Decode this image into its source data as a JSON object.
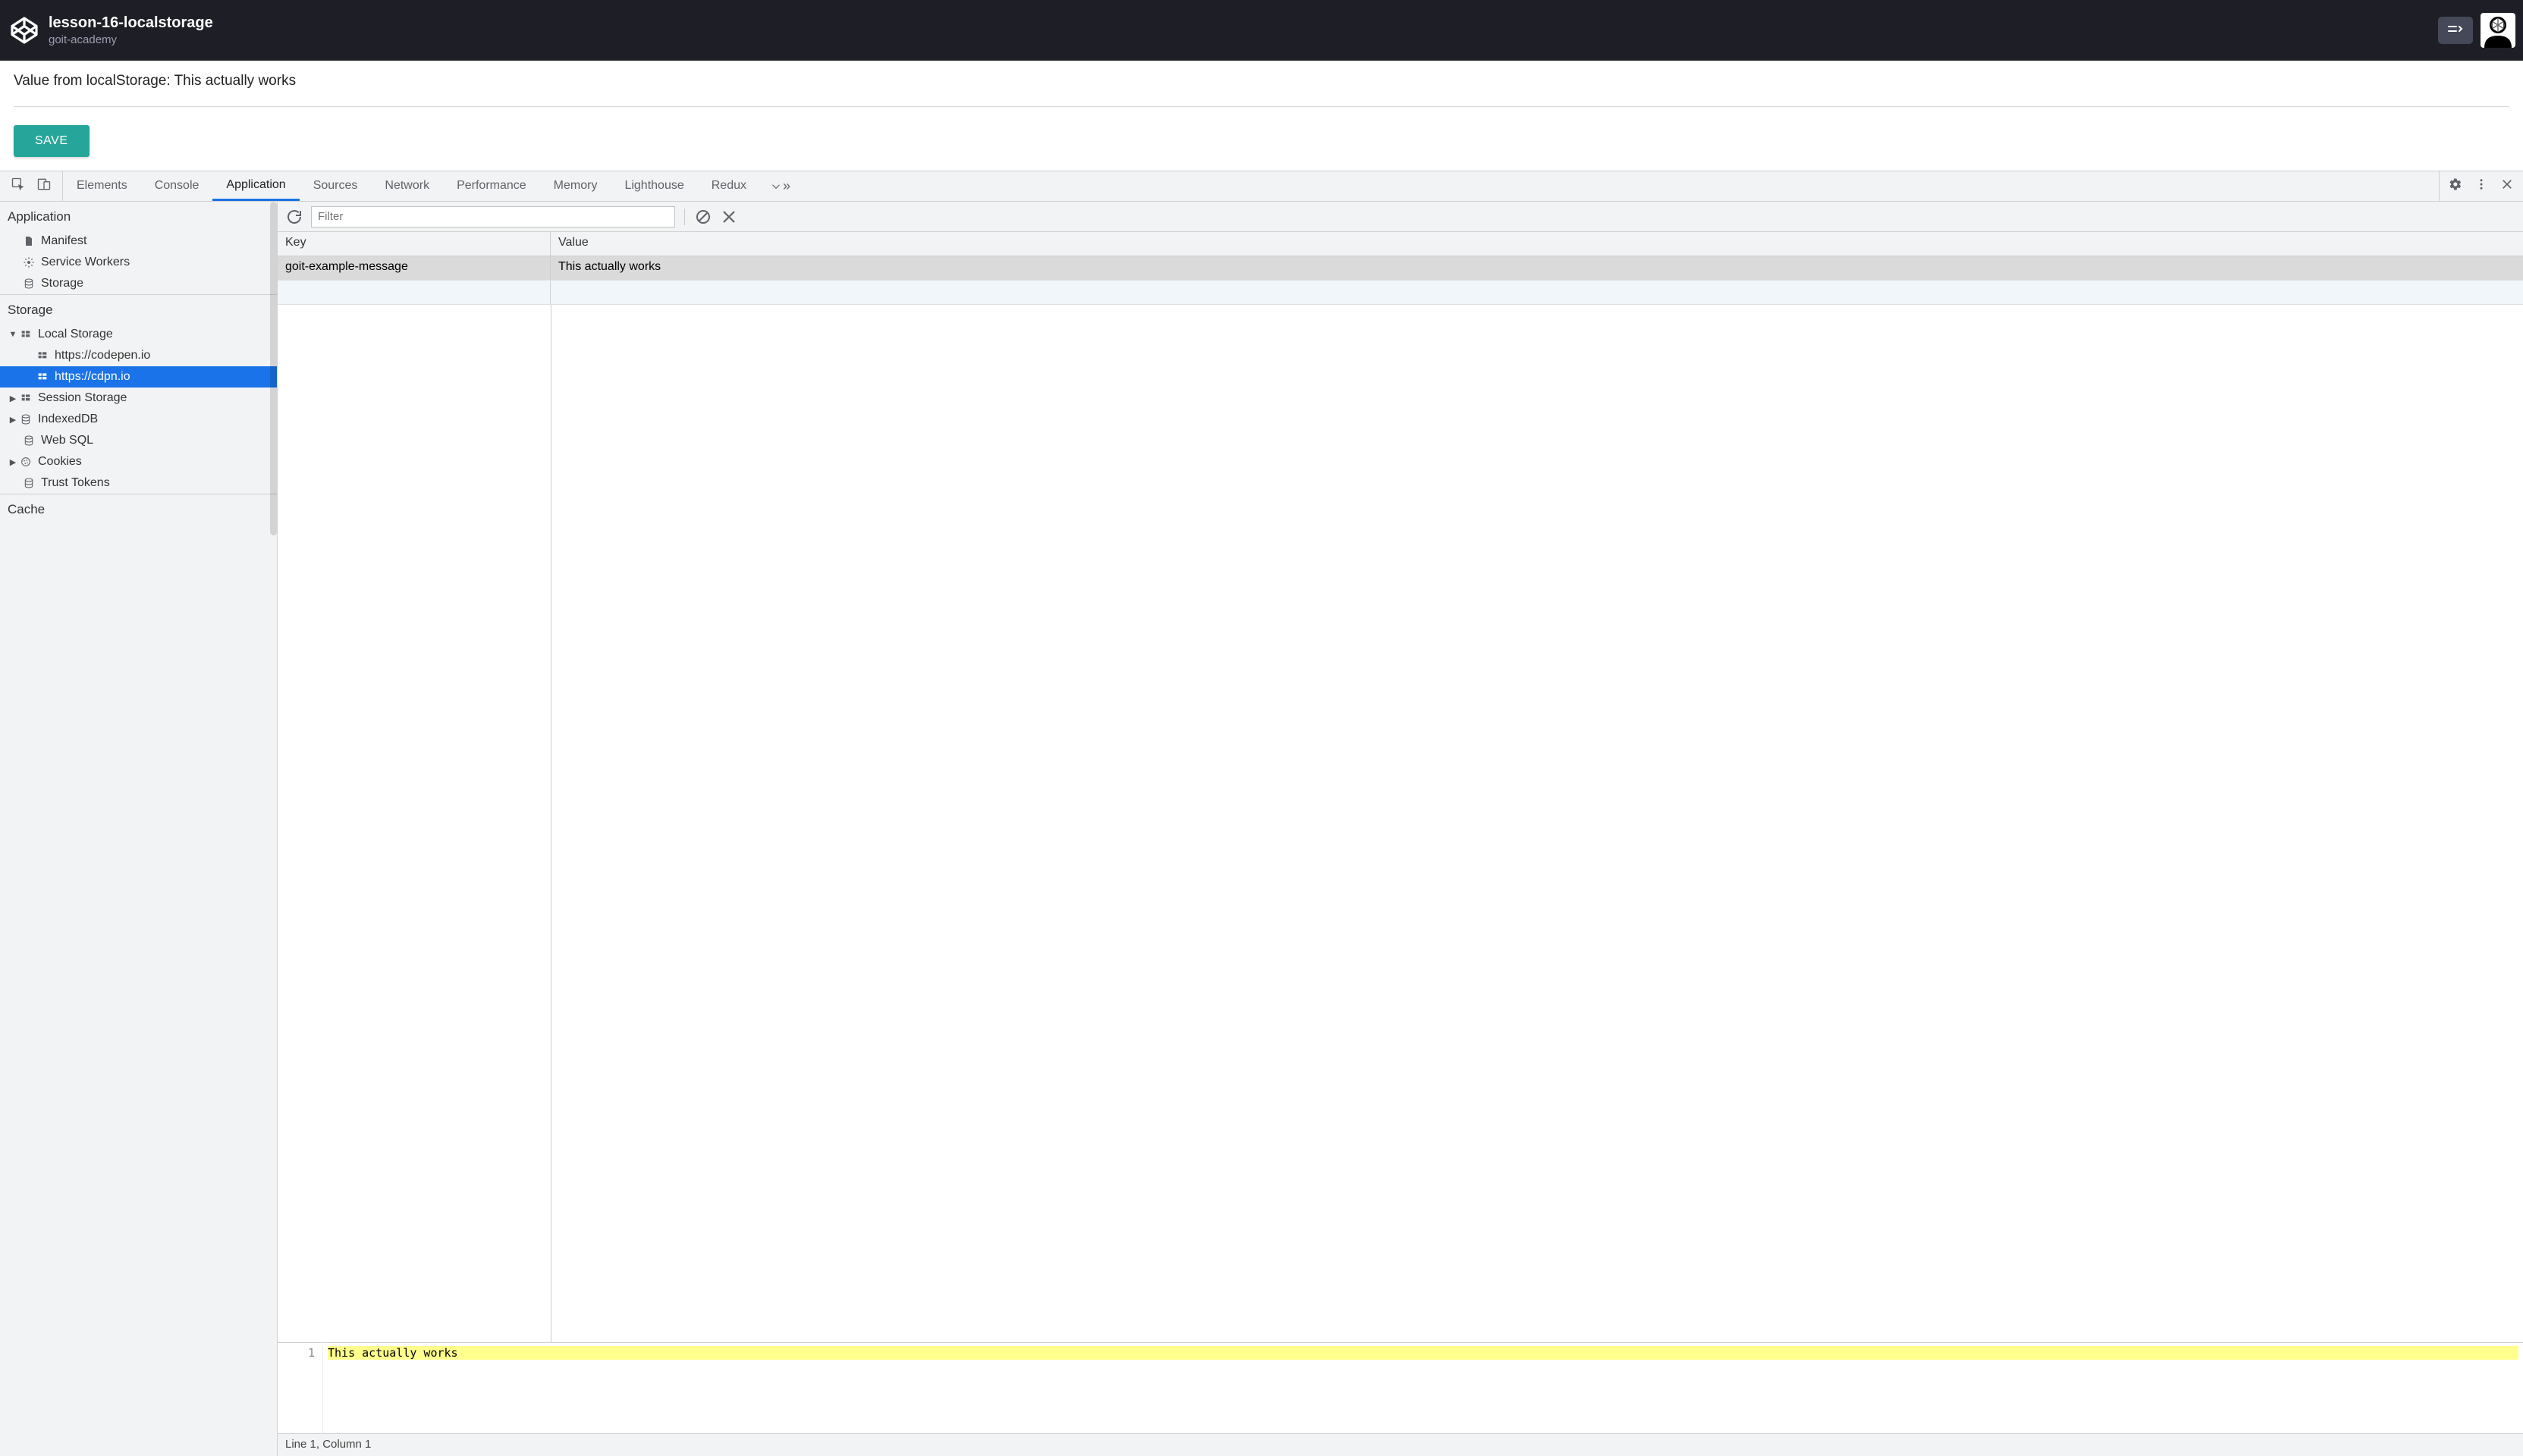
{
  "header": {
    "title": "lesson-16-localstorage",
    "subtitle": "goit-academy"
  },
  "preview": {
    "output_text": "Value from localStorage: This actually works",
    "save_button": "SAVE"
  },
  "devtools": {
    "tabs": [
      "Elements",
      "Console",
      "Application",
      "Sources",
      "Network",
      "Performance",
      "Memory",
      "Lighthouse",
      "Redux"
    ],
    "active_tab": "Application",
    "sidebar": {
      "sections": {
        "application": {
          "title": "Application",
          "items": [
            "Manifest",
            "Service Workers",
            "Storage"
          ]
        },
        "storage": {
          "title": "Storage",
          "local_storage": {
            "label": "Local Storage",
            "origins": [
              "https://codepen.io",
              "https://cdpn.io"
            ],
            "selected": "https://cdpn.io"
          },
          "session_storage": "Session Storage",
          "indexeddb": "IndexedDB",
          "websql": "Web SQL",
          "cookies": "Cookies",
          "trust_tokens": "Trust Tokens"
        },
        "cache": {
          "title": "Cache"
        }
      }
    },
    "toolbar": {
      "filter_placeholder": "Filter"
    },
    "table": {
      "header_key": "Key",
      "header_value": "Value",
      "rows": [
        {
          "key": "goit-example-message",
          "value": "This actually works"
        }
      ]
    },
    "editor": {
      "line_number": "1",
      "content": "This actually works",
      "status": "Line 1, Column 1"
    }
  }
}
